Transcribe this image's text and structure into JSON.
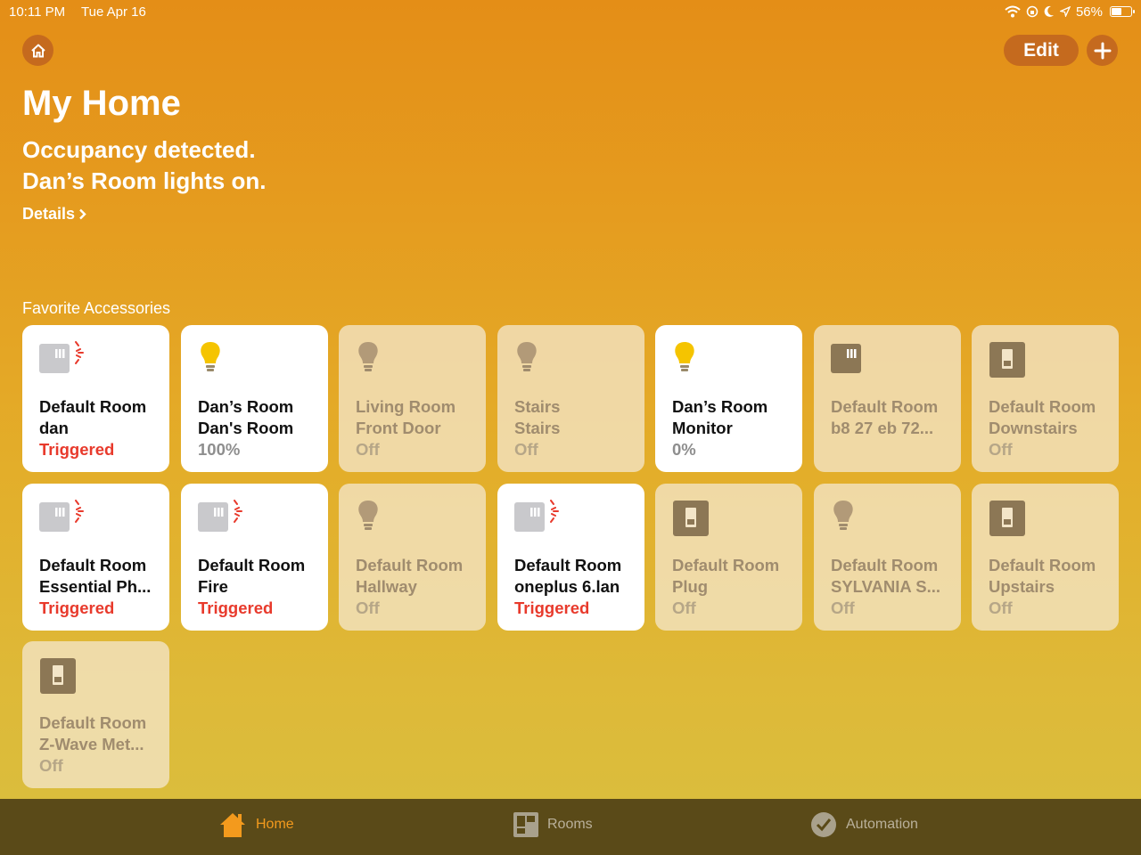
{
  "status_bar": {
    "time": "10:11 PM",
    "date": "Tue Apr 16",
    "battery_percent": "56%",
    "battery_level": 0.56
  },
  "header": {
    "edit_label": "Edit",
    "title": "My Home",
    "status_line_1": "Occupancy detected.",
    "status_line_2": "Dan’s Room lights on.",
    "details_label": "Details"
  },
  "favorites": {
    "section_title": "Favorite Accessories",
    "tiles": [
      {
        "room": "Default Room",
        "name": "dan",
        "state": "Triggered",
        "icon": "sensor-icon",
        "active": true
      },
      {
        "room": "Dan’s Room",
        "name": "Dan's Room",
        "state": "100%",
        "icon": "bulb-icon",
        "active": true
      },
      {
        "room": "Living Room",
        "name": "Front Door",
        "state": "Off",
        "icon": "bulb-icon",
        "active": false
      },
      {
        "room": "Stairs",
        "name": "Stairs",
        "state": "Off",
        "icon": "bulb-icon",
        "active": false
      },
      {
        "room": "Dan’s Room",
        "name": "Monitor",
        "state": "0%",
        "icon": "bulb-icon",
        "active": true
      },
      {
        "room": "Default Room",
        "name": "b8 27 eb 72...",
        "state": "",
        "icon": "sensor-icon",
        "active": false
      },
      {
        "room": "Default Room",
        "name": "Downstairs",
        "state": "Off",
        "icon": "switch-icon",
        "active": false
      },
      {
        "room": "Default Room",
        "name": "Essential Ph...",
        "state": "Triggered",
        "icon": "sensor-icon",
        "active": true
      },
      {
        "room": "Default Room",
        "name": "Fire",
        "state": "Triggered",
        "icon": "sensor-icon",
        "active": true
      },
      {
        "room": "Default Room",
        "name": "Hallway",
        "state": "Off",
        "icon": "bulb-icon",
        "active": false
      },
      {
        "room": "Default Room",
        "name": "oneplus 6.lan",
        "state": "Triggered",
        "icon": "sensor-icon",
        "active": true
      },
      {
        "room": "Default Room",
        "name": "Plug",
        "state": "Off",
        "icon": "switch-icon",
        "active": false
      },
      {
        "room": "Default Room",
        "name": "SYLVANIA S...",
        "state": "Off",
        "icon": "bulb-icon",
        "active": false
      },
      {
        "room": "Default Room",
        "name": "Upstairs",
        "state": "Off",
        "icon": "switch-icon",
        "active": false
      },
      {
        "room": "Default Room",
        "name": "Z-Wave Met...",
        "state": "Off",
        "icon": "switch-icon",
        "active": false
      }
    ]
  },
  "tab_bar": {
    "home_label": "Home",
    "rooms_label": "Rooms",
    "automation_label": "Automation"
  },
  "colors": {
    "triggered": "#e83a2c",
    "bulb_on": "#f5c400",
    "accent": "#f39a1d"
  }
}
